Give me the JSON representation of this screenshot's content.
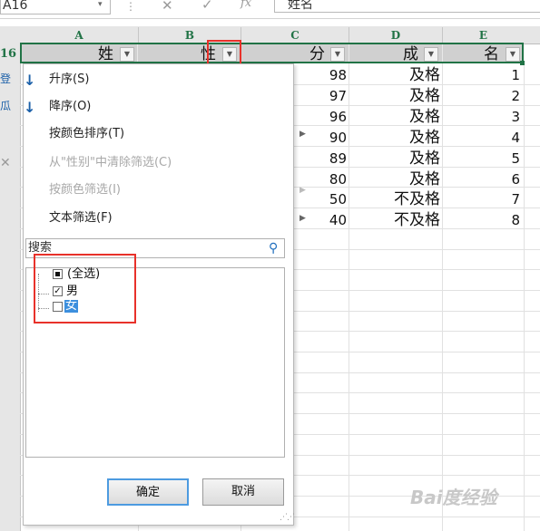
{
  "formula_bar": {
    "name_box": "A16",
    "cancel_icon": "✕",
    "enter_icon": "✓",
    "fx_label": "fx",
    "formula": "姓名"
  },
  "columns": [
    "A",
    "B",
    "C",
    "D",
    "E"
  ],
  "active_row_header": "16",
  "header_cells": [
    "姓",
    "性",
    "分",
    "成",
    "名"
  ],
  "rows": [
    {
      "score": "98",
      "grade": "及格",
      "rank": "1"
    },
    {
      "score": "97",
      "grade": "及格",
      "rank": "2"
    },
    {
      "score": "96",
      "grade": "及格",
      "rank": "3"
    },
    {
      "score": "90",
      "grade": "及格",
      "rank": "4"
    },
    {
      "score": "89",
      "grade": "及格",
      "rank": "5"
    },
    {
      "score": "80",
      "grade": "及格",
      "rank": "6"
    },
    {
      "score": "50",
      "grade": "不及格",
      "rank": "7"
    },
    {
      "score": "40",
      "grade": "不及格",
      "rank": "8"
    }
  ],
  "filter_menu": {
    "sort_asc": "升序(S)",
    "sort_desc": "降序(O)",
    "sort_by_color": "按颜色排序(T)",
    "clear_filter": "从\"性别\"中清除筛选(C)",
    "filter_by_color": "按颜色筛选(I)",
    "text_filter": "文本筛选(F)",
    "search_placeholder": "搜索",
    "list": [
      {
        "label": "(全选)",
        "state": "partial"
      },
      {
        "label": "男",
        "state": "checked"
      },
      {
        "label": "女",
        "state": "unchecked"
      }
    ],
    "ok_label": "确定",
    "cancel_label": "取消"
  },
  "icons": {
    "sort_asc": "sort-ascending-icon",
    "sort_desc": "sort-descending-icon",
    "clear_filter": "clear-filter-icon",
    "search": "search-icon",
    "dropdown": "dropdown-arrow-icon",
    "submenu": "chevron-right-icon"
  },
  "colors": {
    "excel_green": "#217346",
    "highlight_red": "#e8312a",
    "selection_blue": "#3c8fde"
  },
  "watermark": "Bai度经验"
}
